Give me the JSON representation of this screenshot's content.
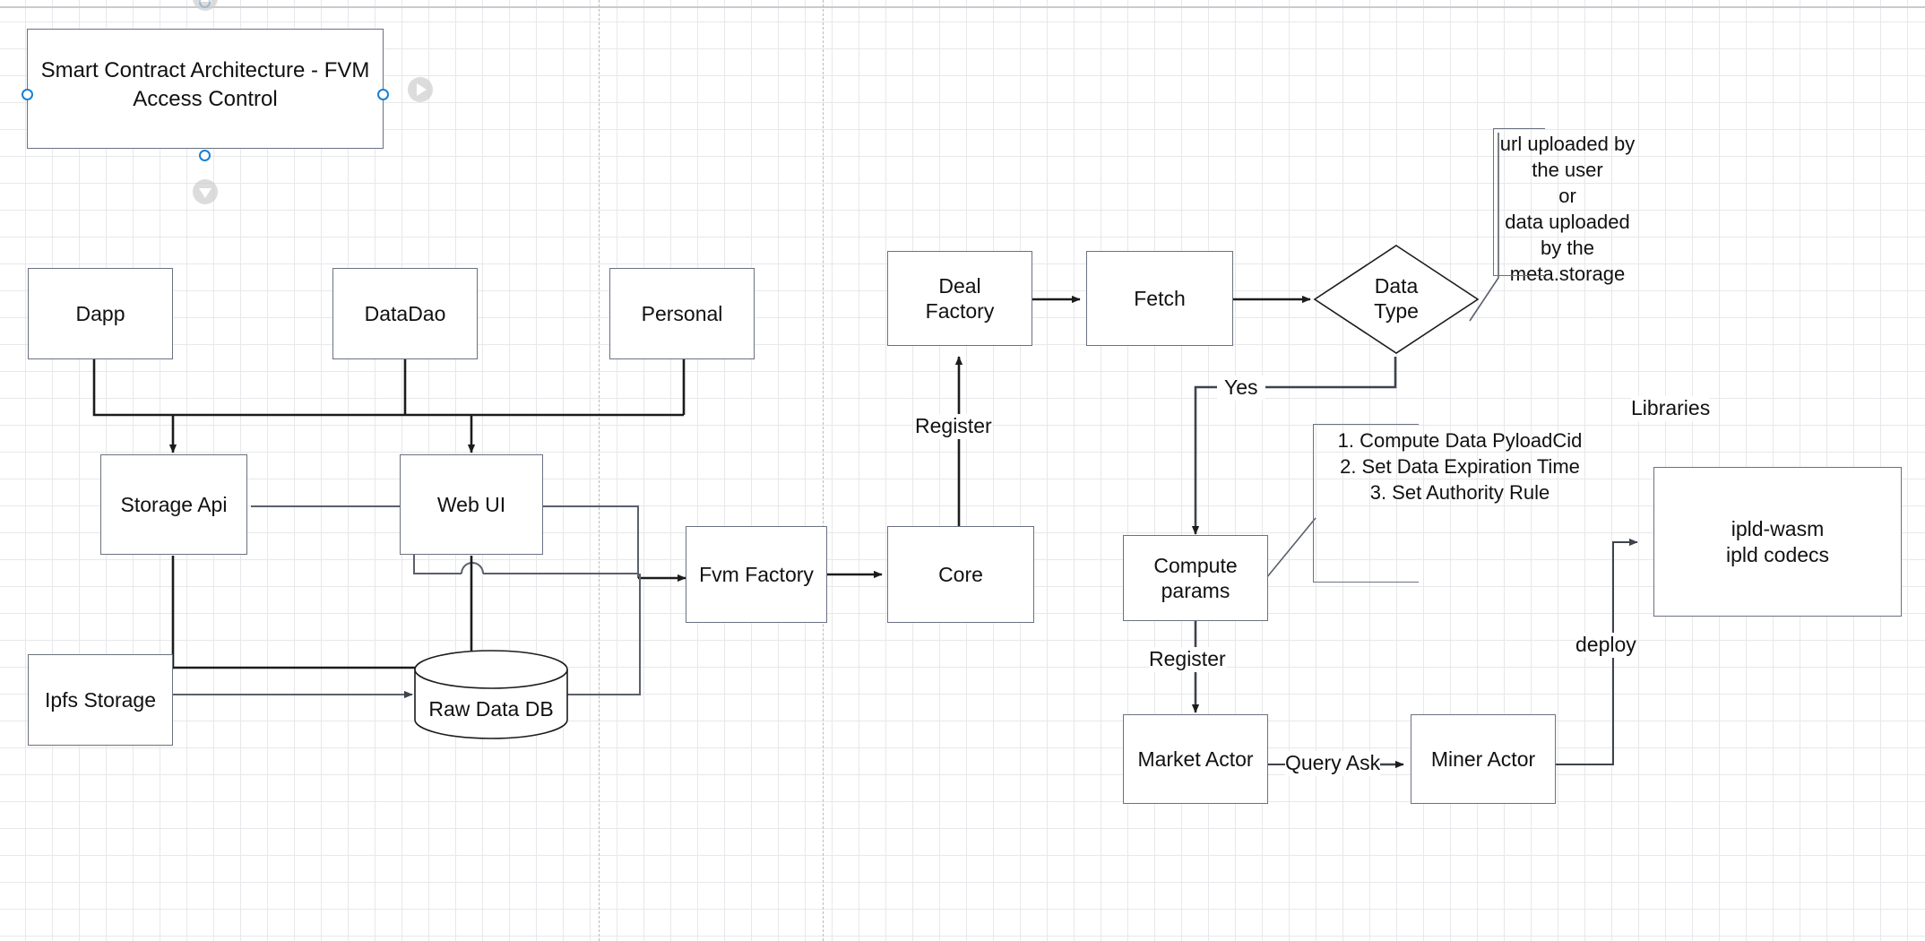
{
  "diagram": {
    "title_shape": {
      "text": "Smart Contract Architecture  - FVM\nAccess Control"
    },
    "nodes": [
      {
        "id": "dapp",
        "label": "Dapp"
      },
      {
        "id": "datadao",
        "label": "DataDao"
      },
      {
        "id": "personal",
        "label": "Personal"
      },
      {
        "id": "storage-api",
        "label": "Storage Api"
      },
      {
        "id": "web-ui",
        "label": "Web UI"
      },
      {
        "id": "ipfs-storage",
        "label": "Ipfs Storage"
      },
      {
        "id": "raw-data-db",
        "label": "Raw Data DB"
      },
      {
        "id": "fvm-factory",
        "label": "Fvm Factory"
      },
      {
        "id": "core",
        "label": "Core"
      },
      {
        "id": "deal-factory",
        "label": "Deal\nFactory"
      },
      {
        "id": "fetch",
        "label": "Fetch"
      },
      {
        "id": "data-type",
        "label": "Data\nType"
      },
      {
        "id": "compute-params",
        "label": "Compute\nparams"
      },
      {
        "id": "market-actor",
        "label": "Market Actor"
      },
      {
        "id": "miner-actor",
        "label": "Miner Actor"
      },
      {
        "id": "ipld-wasm",
        "label": "ipld-wasm\nipld codecs"
      }
    ],
    "notes": [
      {
        "id": "data-type-note",
        "text": "url uploaded by\nthe user\nor\ndata uploaded\nby the\nmeta.storage"
      },
      {
        "id": "compute-params-note",
        "text": "1. Compute Data PyloadCid\n2. Set Data Expiration Time\n3. Set Authority Rule"
      }
    ],
    "group_labels": [
      {
        "id": "libraries",
        "text": "Libraries"
      }
    ],
    "edge_labels": [
      {
        "id": "register-deal-factory",
        "text": "Register"
      },
      {
        "id": "yes-branch",
        "text": "Yes"
      },
      {
        "id": "register-market-actor",
        "text": "Register"
      },
      {
        "id": "query-ask",
        "text": "Query Ask"
      },
      {
        "id": "deploy",
        "text": "deploy"
      }
    ],
    "colors": {
      "node_stroke": "#6a7180",
      "node_fill": "#ffffff",
      "edge_dark": "#1c1c1c",
      "edge_gray": "#5a606c",
      "text": "#111111",
      "grid_minor": "#e8e8ec",
      "grid_major": "#d2d2d8",
      "selection": "#1a7fd4"
    }
  }
}
